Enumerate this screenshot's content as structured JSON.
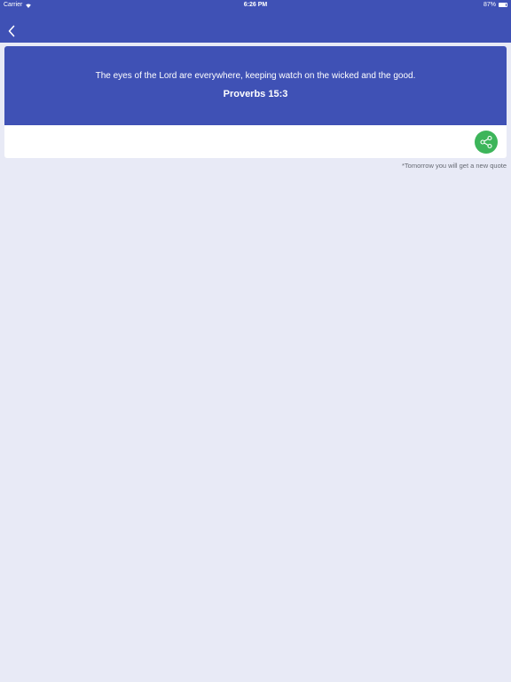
{
  "status_bar": {
    "carrier": "Carrier",
    "time": "6:26 PM",
    "battery": "87%",
    "battery_level": 0.87
  },
  "nav": {
    "back_icon": "chevron-left-icon"
  },
  "quote": {
    "text": "The eyes of the Lord are everywhere, keeping watch on the wicked and the good.",
    "reference": "Proverbs 15:3"
  },
  "share": {
    "icon": "share-icon",
    "color": "#3db55a"
  },
  "footnote": "*Tomorrow you will get a new quote",
  "colors": {
    "primary": "#3f51b5",
    "background": "#e8eaf6"
  }
}
